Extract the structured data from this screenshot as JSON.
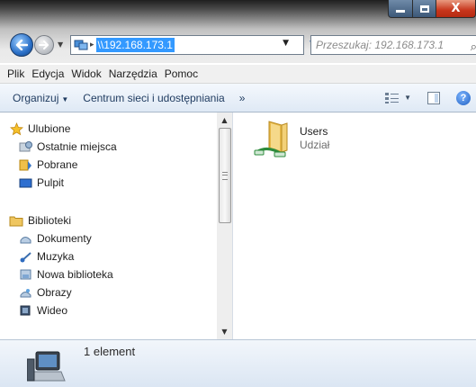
{
  "window": {
    "minimize": "minimize-icon",
    "maximize": "maximize-icon",
    "close_glyph": "X"
  },
  "address": {
    "path": "\\\\192.168.173.1",
    "refresh_glyph": "↻"
  },
  "search": {
    "placeholder": "Przeszukaj: 192.168.173.1"
  },
  "menu": [
    "Plik",
    "Edycja",
    "Widok",
    "Narzędzia",
    "Pomoc"
  ],
  "commands": {
    "organize": "Organizuj",
    "network_center": "Centrum sieci i udostępniania",
    "more": "»",
    "help_glyph": "?"
  },
  "navigation": {
    "favorites_header": "Ulubione",
    "favorites": [
      "Ostatnie miejsca",
      "Pobrane",
      "Pulpit"
    ],
    "libraries_header": "Biblioteki",
    "libraries": [
      "Dokumenty",
      "Muzyka",
      "Nowa biblioteka",
      "Obrazy",
      "Wideo"
    ]
  },
  "content": {
    "items": [
      {
        "name": "Users",
        "type": "Udział"
      }
    ]
  },
  "details": {
    "count_text": "1 element"
  },
  "colors": {
    "accent": "#3399ff",
    "command_text": "#1e3a5f",
    "close_button": "#c7361c"
  }
}
